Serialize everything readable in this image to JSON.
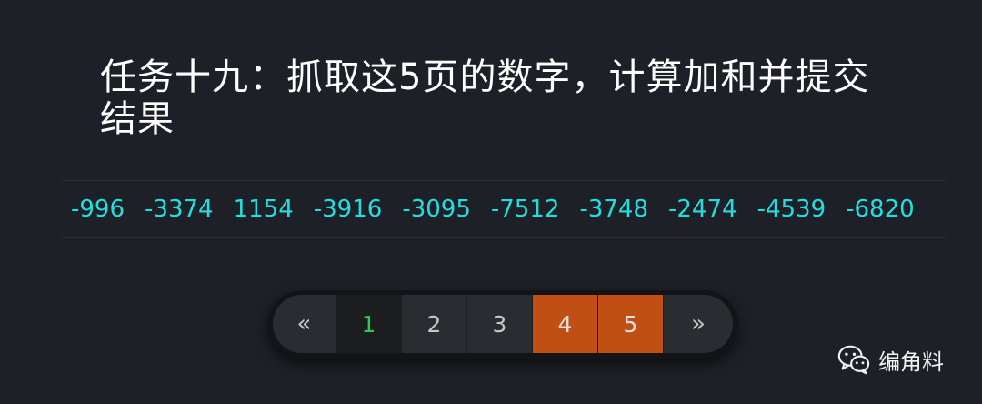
{
  "task": {
    "title": "任务十九：抓取这5页的数字，计算加和并提交结果"
  },
  "numbers": [
    "-996",
    "-3374",
    "1154",
    "-3916",
    "-3095",
    "-7512",
    "-3748",
    "-2474",
    "-4539",
    "-6820"
  ],
  "pagination": {
    "prev_label": "«",
    "next_label": "»",
    "pages": [
      "1",
      "2",
      "3",
      "4",
      "5"
    ],
    "current_page": "1",
    "highlighted_pages": [
      "4",
      "5"
    ]
  },
  "watermark": {
    "icon": "wechat-icon",
    "text": "编角料"
  },
  "colors": {
    "background": "#1e2027",
    "numbers": "#22dede",
    "current_page": "#2ec94f",
    "highlighted_page_bg": "#c14e13"
  }
}
